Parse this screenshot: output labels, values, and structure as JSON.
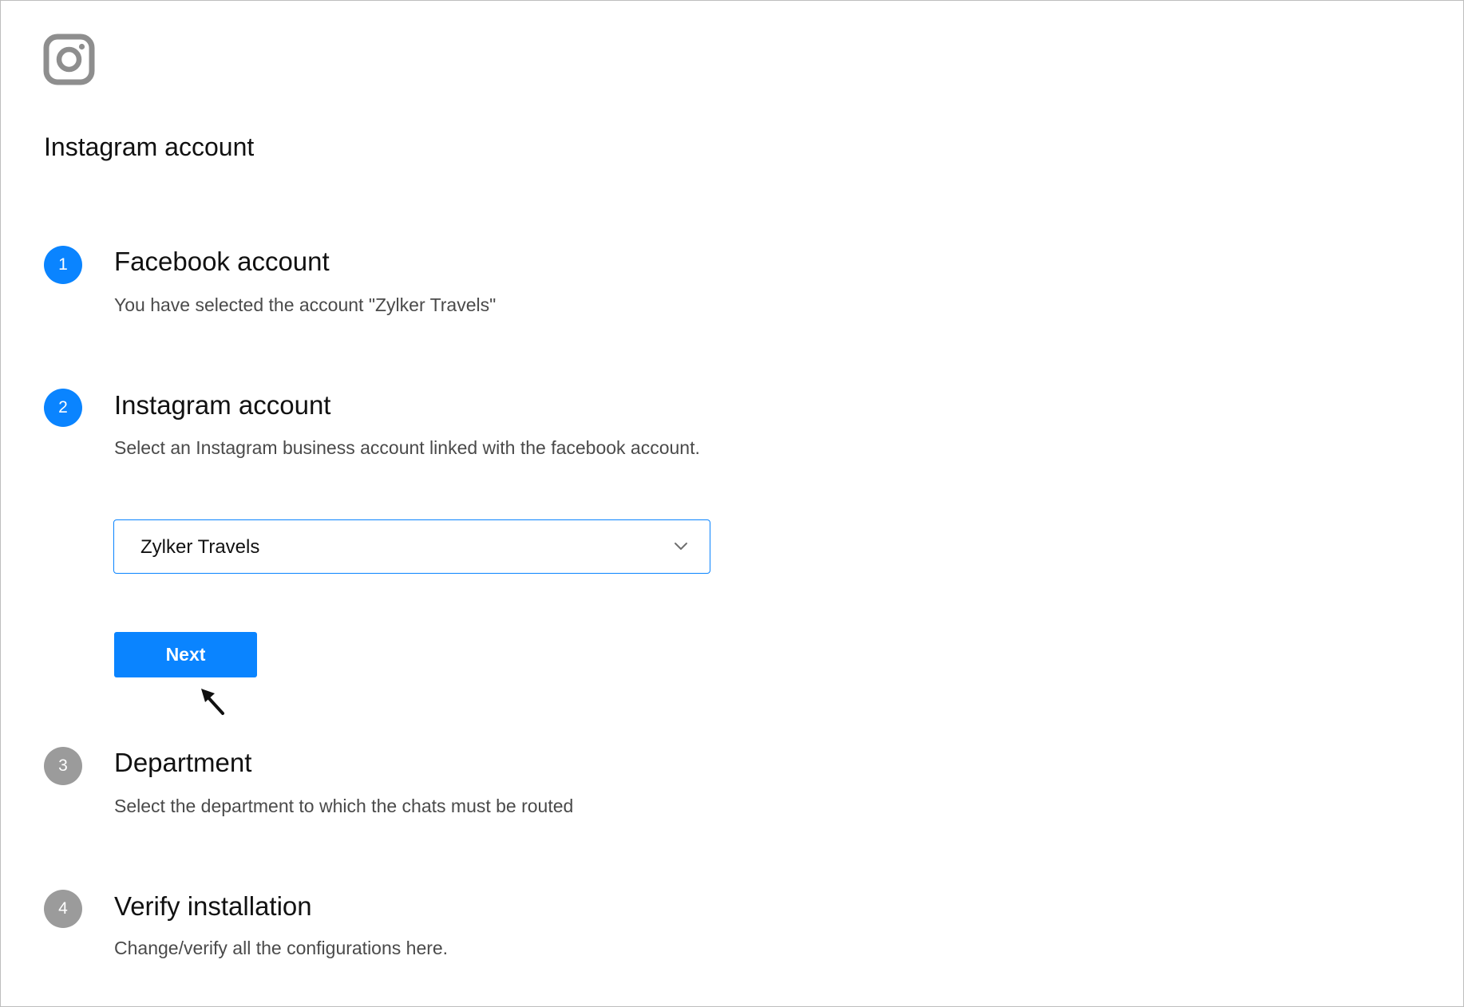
{
  "header": {
    "logo_icon": "instagram-icon",
    "title": "Instagram account"
  },
  "steps": [
    {
      "number": "1",
      "title": "Facebook account",
      "description": "You have selected the account \"Zylker Travels\"",
      "state": "active"
    },
    {
      "number": "2",
      "title": "Instagram account",
      "description": "Select an Instagram business account linked with the facebook account.",
      "state": "active"
    },
    {
      "number": "3",
      "title": "Department",
      "description": "Select the department to which the chats must be routed",
      "state": "inactive"
    },
    {
      "number": "4",
      "title": "Verify installation",
      "description": "Change/verify all the configurations here.",
      "state": "inactive"
    }
  ],
  "account_select": {
    "selected": "Zylker Travels",
    "icon": "chevron-down-icon"
  },
  "next_button": {
    "label": "Next"
  },
  "colors": {
    "accent": "#0a84ff",
    "inactive_step": "#9b9b9b",
    "icon_gray": "#8e8e8e",
    "description_text": "#4a4a4a"
  }
}
